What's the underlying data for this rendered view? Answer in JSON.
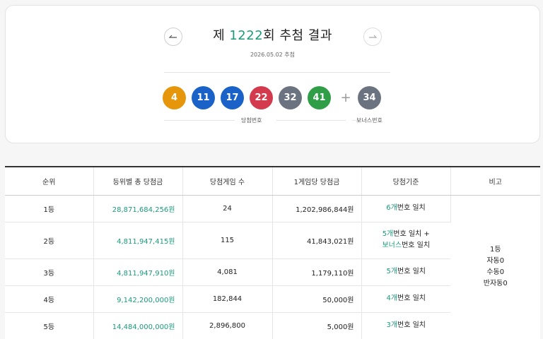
{
  "header": {
    "title_prefix": "제 ",
    "round": "1222",
    "title_suffix": "회 추첨 결과",
    "date": "2026.05.02 추첨"
  },
  "winning_numbers": [
    {
      "number": "4",
      "color": "#e6960a"
    },
    {
      "number": "11",
      "color": "#1a62c8"
    },
    {
      "number": "17",
      "color": "#1a62c8"
    },
    {
      "number": "22",
      "color": "#d43a4e"
    },
    {
      "number": "32",
      "color": "#6b7280"
    },
    {
      "number": "41",
      "color": "#2f9e47"
    }
  ],
  "plus_sign": "+",
  "bonus_number": {
    "number": "34",
    "color": "#6b7280"
  },
  "winning_caption": "당첨번호",
  "bonus_caption": "보너스번호",
  "table": {
    "headers": [
      "순위",
      "등위별 총 당첨금",
      "당첨게임 수",
      "1게임당 당첨금",
      "당첨기준",
      "비고"
    ],
    "rows": [
      {
        "rank": "1등",
        "total": "28,871,684,256원",
        "winners": "24",
        "per_game": "1,202,986,844원",
        "crit_num": "6개",
        "crit_text": "번호 일치"
      },
      {
        "rank": "2등",
        "total": "4,811,947,415원",
        "winners": "115",
        "per_game": "41,843,021원",
        "crit_num": "5개",
        "crit_text": "번호 일치 +",
        "crit_num2": "보너스",
        "crit_text2": "번호 일치"
      },
      {
        "rank": "3등",
        "total": "4,811,947,910원",
        "winners": "4,081",
        "per_game": "1,179,110원",
        "crit_num": "5개",
        "crit_text": "번호 일치"
      },
      {
        "rank": "4등",
        "total": "9,142,200,000원",
        "winners": "182,844",
        "per_game": "50,000원",
        "crit_num": "4개",
        "crit_text": "번호 일치"
      },
      {
        "rank": "5등",
        "total": "14,484,000,000원",
        "winners": "2,896,800",
        "per_game": "5,000원",
        "crit_num": "3개",
        "crit_text": "번호 일치"
      }
    ],
    "note": [
      "1등",
      "자동0",
      "수동0",
      "반자동0"
    ]
  },
  "colors": {
    "accent": "#1b9b7a"
  }
}
